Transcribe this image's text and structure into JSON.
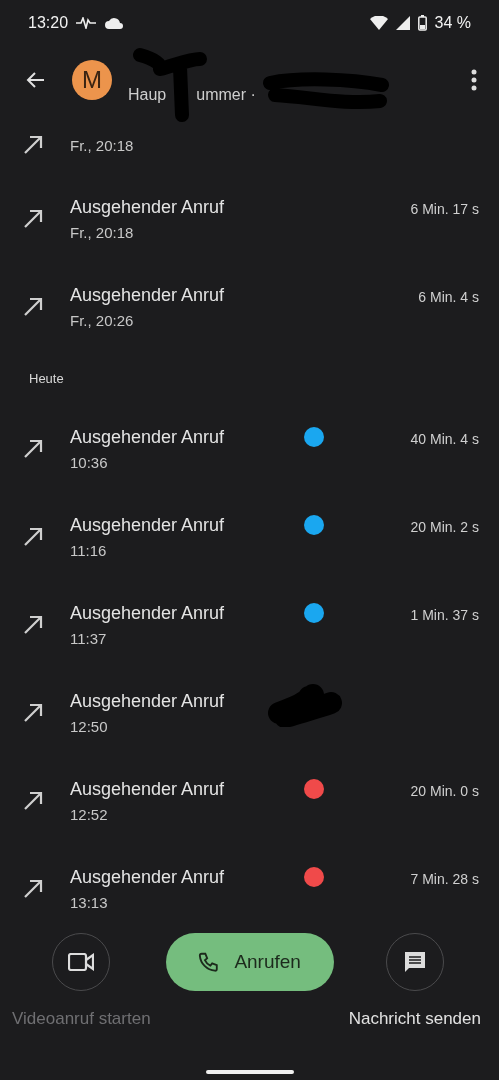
{
  "status_bar": {
    "time": "13:20",
    "battery": "34 %"
  },
  "header": {
    "avatar_letter": "M",
    "subtitle_parts": [
      "Haup",
      "ummer ·"
    ],
    "redacted": true
  },
  "sections": [
    {
      "calls": [
        {
          "time": "Fr., 20:18"
        },
        {
          "title": "Ausgehender Anruf",
          "time": "Fr., 20:18",
          "duration": "6 Min. 17 s"
        },
        {
          "title": "Ausgehender Anruf",
          "time": "Fr., 20:26",
          "duration": "6 Min. 4 s"
        }
      ]
    },
    {
      "heading": "Heute",
      "calls": [
        {
          "title": "Ausgehender Anruf",
          "time": "10:36",
          "duration": "40 Min. 4 s",
          "color": "#1aa7f0"
        },
        {
          "title": "Ausgehender Anruf",
          "time": "11:16",
          "duration": "20 Min. 2 s",
          "color": "#1aa7f0"
        },
        {
          "title": "Ausgehender Anruf",
          "time": "11:37",
          "duration": "1 Min. 37 s",
          "color": "#1aa7f0"
        },
        {
          "title": "Ausgehender Anruf",
          "time": "12:50",
          "redacted": true
        },
        {
          "title": "Ausgehender Anruf",
          "time": "12:52",
          "duration": "20 Min. 0 s",
          "color": "#f04a4a"
        },
        {
          "title": "Ausgehender Anruf",
          "time": "13:13",
          "duration": "7 Min. 28 s",
          "color": "#f04a4a"
        }
      ]
    }
  ],
  "actions": [
    {
      "kind": "video",
      "label": "Videoanruf starten",
      "disabled": true
    },
    {
      "kind": "call",
      "label": "Anrufen"
    },
    {
      "kind": "message",
      "label": "Nachricht senden",
      "disabled": false
    }
  ]
}
